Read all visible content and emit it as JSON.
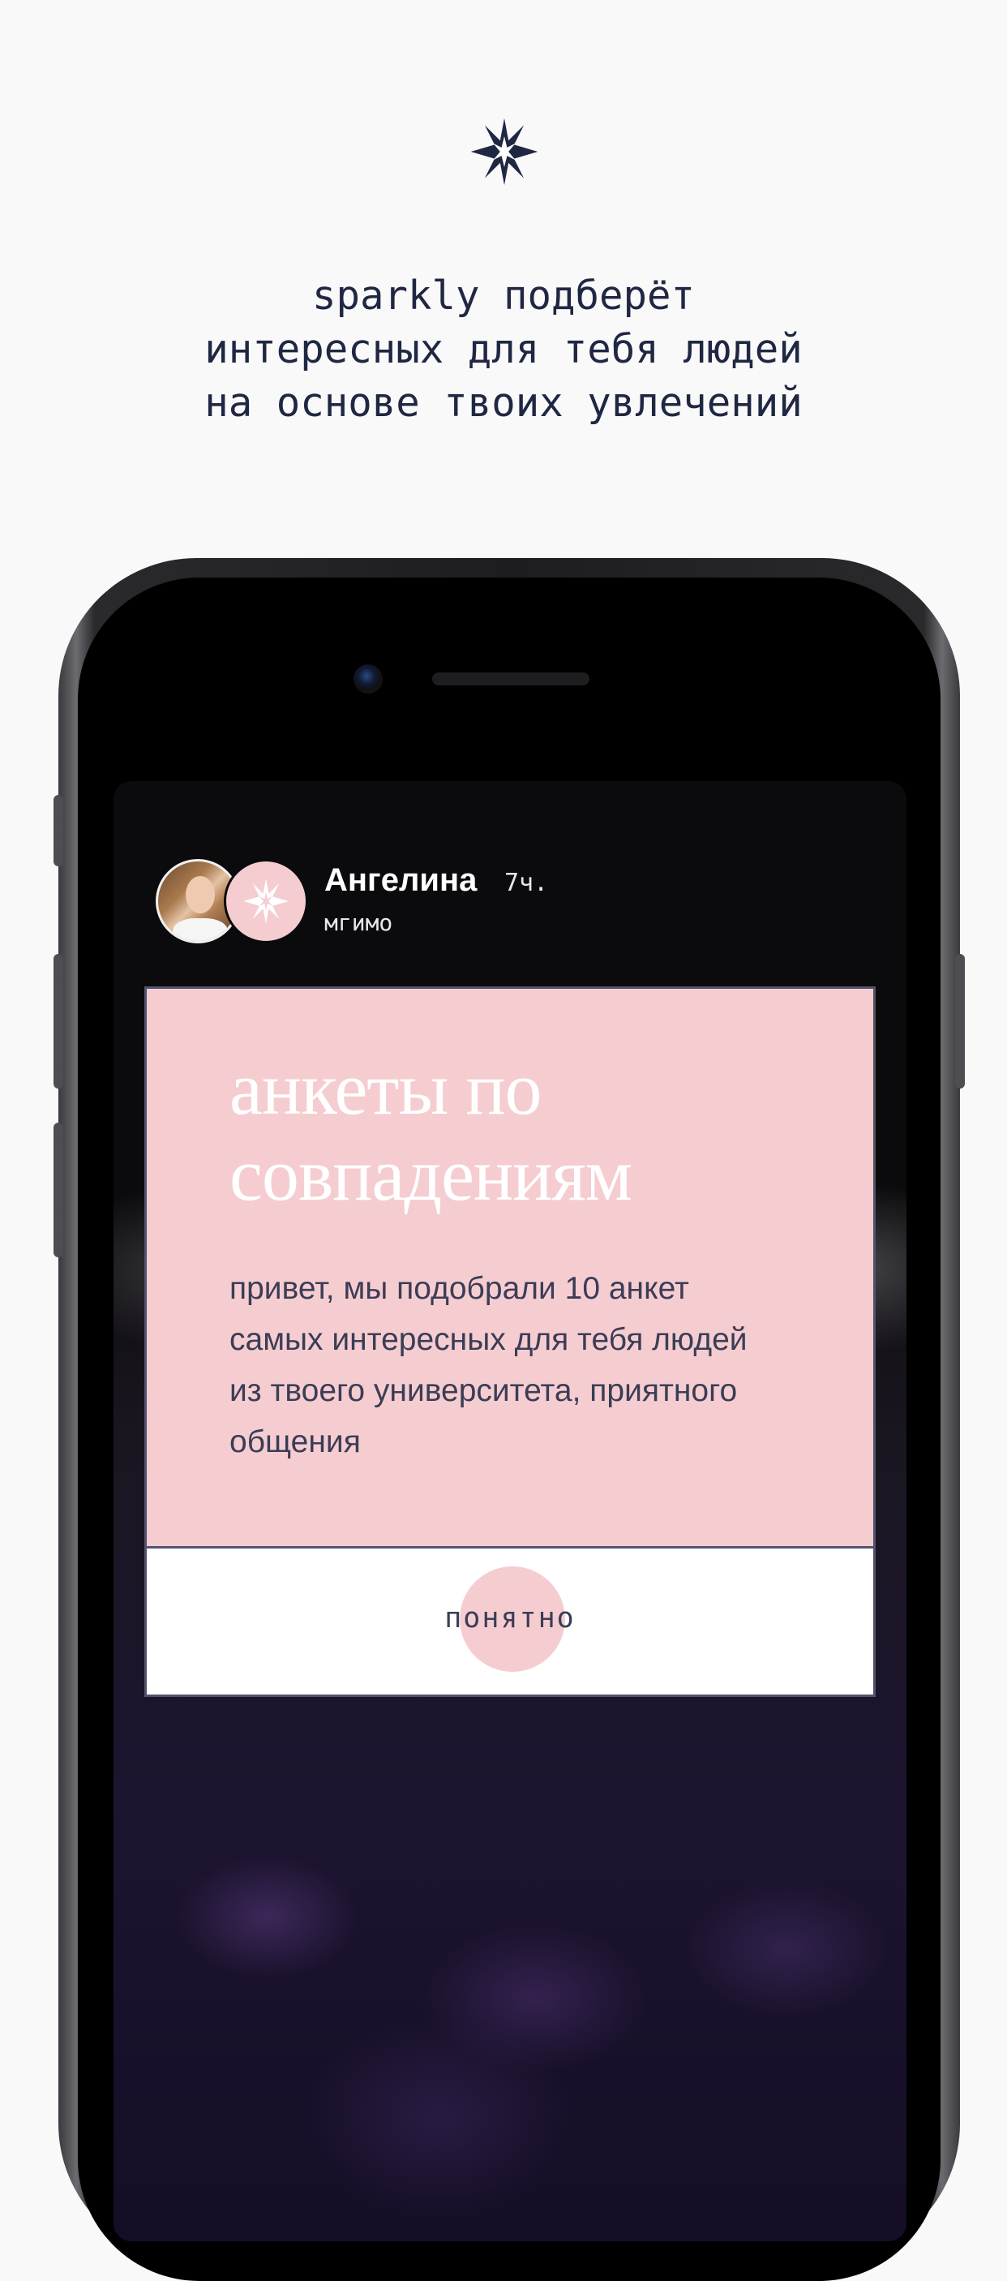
{
  "intro": {
    "icon": "sparkle-star-icon",
    "headline_lines": [
      "sparkly подберёт",
      "интересных для тебя людей",
      "на основе твоих увлечений"
    ]
  },
  "post": {
    "user_name": "Ангелина",
    "time_ago": "7ч.",
    "university": "мгимо",
    "avatar_icon": "user-avatar",
    "badge_icon": "sparkle-star-icon"
  },
  "card": {
    "title_lines": [
      "анкеты по",
      "совпадениям"
    ],
    "body": "привет, мы подобрали 10 анкет самых интересных для тебя людей из твоего университета, приятного общения",
    "button_label": "понятно"
  },
  "colors": {
    "background": "#f9f9fa",
    "text_dark": "#1f2742",
    "card_pink": "#f5cdd1",
    "card_border": "#52536c",
    "body_text": "#3b3d55"
  }
}
